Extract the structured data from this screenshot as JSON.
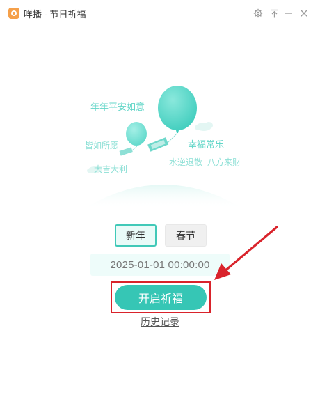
{
  "window": {
    "title": "咩播 - 节日祈福",
    "logo_icon": "app-logo-icon",
    "controls": [
      "settings-icon",
      "pin-top-icon",
      "minimize-icon",
      "close-icon"
    ]
  },
  "illustration": {
    "texts": {
      "t1": "年年平安如意",
      "t2": "皆如所愿",
      "t3": "幸福常乐",
      "t4": "大吉大利",
      "t5": "水逆退散",
      "t6": "八方来财"
    },
    "colors": {
      "balloon": "#5fd9cb",
      "balloon_light": "#b8efe8",
      "cloud": "#dff6f3"
    }
  },
  "tabs": [
    {
      "label": "新年",
      "selected": true
    },
    {
      "label": "春节",
      "selected": false
    }
  ],
  "datetime_value": "2025-01-01 00:00:00",
  "start_button_label": "开启祈福",
  "history_link_label": "历史记录",
  "colors": {
    "accent": "#36c6b5",
    "annotation": "#d9232b"
  }
}
